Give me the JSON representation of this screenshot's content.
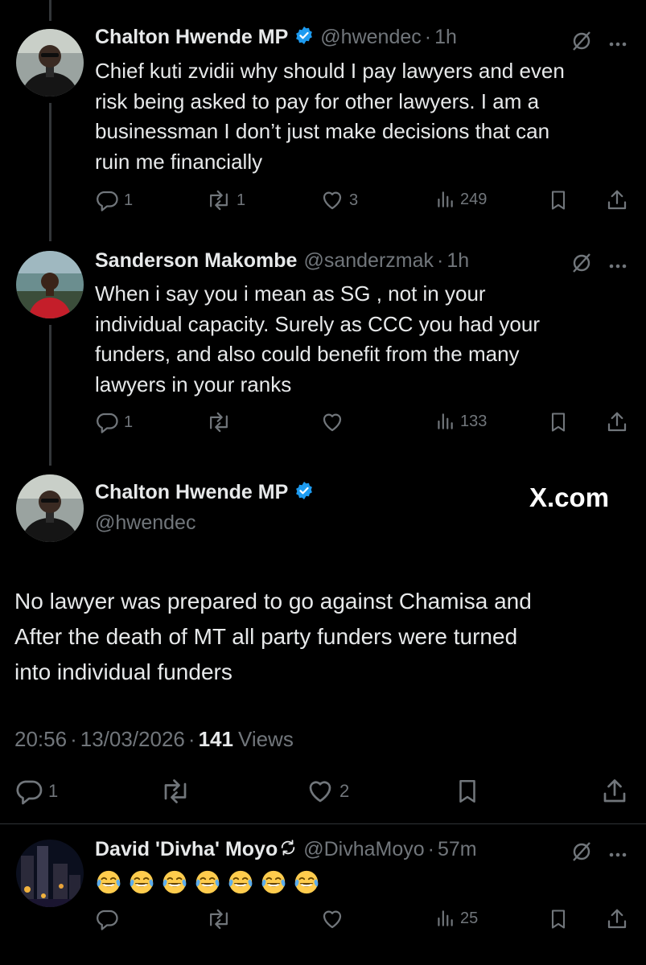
{
  "tweet1": {
    "name": "Chalton Hwende MP",
    "handle": "@hwendec",
    "sep": "·",
    "time": "1h",
    "text_lines": [
      "Chief kuti zvidii why should I pay lawyers and even",
      "risk being asked to pay for other lawyers. I am a",
      "businessman I don’t just make decisions that can",
      "ruin me  financially"
    ],
    "replies": "1",
    "reposts": "1",
    "likes": "3",
    "views": "249"
  },
  "tweet2": {
    "name": "Sanderson Makombe",
    "handle": "@sanderzmak",
    "sep": "·",
    "time": "1h",
    "text_lines": [
      "When i say you i mean as SG , not in your",
      "individual capacity. Surely as CCC you had your",
      "funders, and also could benefit from the many",
      "lawyers in your ranks"
    ],
    "replies": "1",
    "views": "133"
  },
  "main_tweet": {
    "name": "Chalton Hwende MP",
    "handle": "@hwendec",
    "watermark": "X.com",
    "text_lines": [
      "No lawyer was prepared to go against Chamisa and",
      "After the death of MT all party funders were turned",
      "into individual funders"
    ],
    "time": "20:56",
    "date": "13/03/2026",
    "sep": "·",
    "views_count": "141",
    "views_label": "Views",
    "replies": "1",
    "likes": "2"
  },
  "reply": {
    "name": "David 'Divha' Moyo",
    "handle": "@DivhaMoyo",
    "sep": "·",
    "time": "57m",
    "emoji_count": 7,
    "emoji_name": "face-with-tears-of-joy",
    "views": "25"
  },
  "colors": {
    "background": "#000000",
    "text": "#e7e9ea",
    "muted": "#71767b",
    "verified": "#1d9bf0",
    "divider": "#2f3336"
  }
}
